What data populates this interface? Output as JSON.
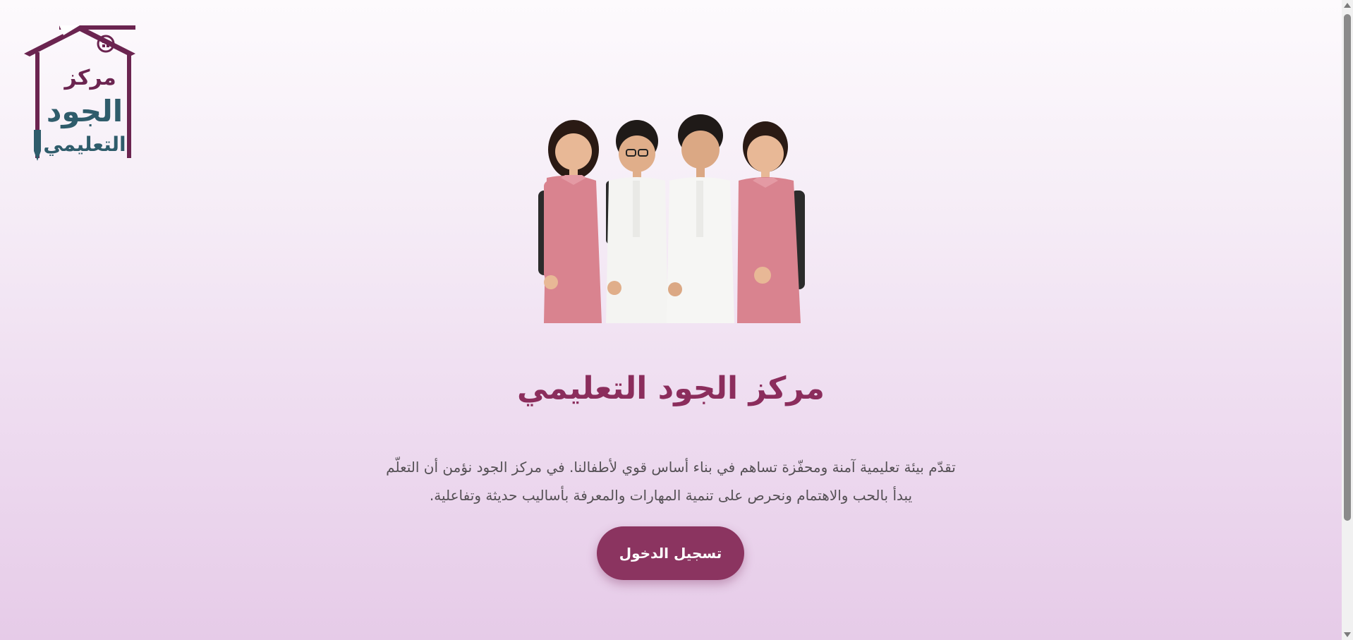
{
  "logo": {
    "icon": "house-pencil-logo",
    "lines": [
      "مركز",
      "الجود",
      "التعليمي"
    ]
  },
  "hero": {
    "image": "four-children-school-uniforms-photo"
  },
  "main": {
    "title": "مركز الجود التعليمي",
    "description_line1": "تقدّم بيئة تعليمية آمنة ومحفّزة تساهم في بناء أساس قوي لأطفالنا. في مركز الجود نؤمن أن التعلّم",
    "description_line2": "يبدأ بالحب والاهتمام ونحرص على تنمية المهارات والمعرفة بأساليب حديثة وتفاعلية.",
    "login_button": "تسجيل الدخول"
  },
  "colors": {
    "brand": "#8b2d5c",
    "button": "#8b3460",
    "logo_teal": "#2f5c6b"
  }
}
